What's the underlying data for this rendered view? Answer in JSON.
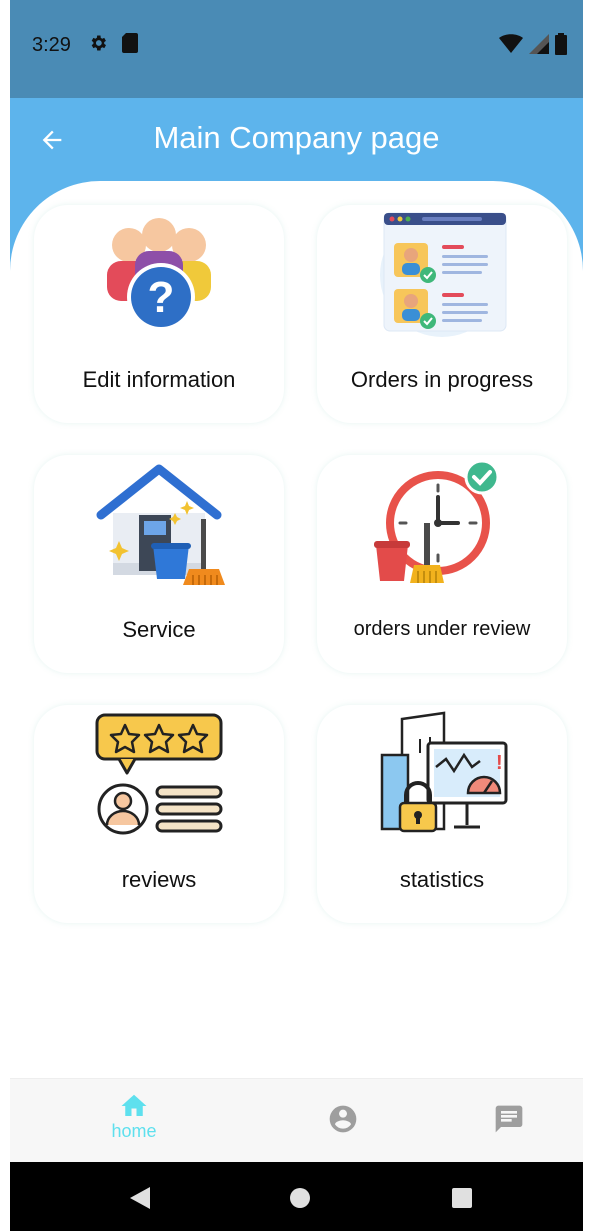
{
  "status_bar": {
    "time": "3:29",
    "icons_left": [
      "gear-icon",
      "sd-card-icon"
    ],
    "icons_right": [
      "wifi-icon",
      "signal-icon",
      "battery-icon"
    ]
  },
  "app_bar": {
    "title": "Main Company page",
    "back_icon": "arrow-left-icon",
    "color": "#5db4ec"
  },
  "cards": [
    {
      "label": "Edit information",
      "icon": "people-question-icon"
    },
    {
      "label": "Orders in progress",
      "icon": "approved-profiles-icon"
    },
    {
      "label": "Service",
      "icon": "house-cleaning-icon"
    },
    {
      "label": "orders under review",
      "icon": "clock-broom-check-icon"
    },
    {
      "label": "reviews",
      "icon": "rating-reviews-icon"
    },
    {
      "label": "statistics",
      "icon": "statistics-security-icon"
    }
  ],
  "bottom_nav": {
    "items": [
      {
        "label": "home",
        "icon": "home-icon",
        "active": true
      },
      {
        "label": "",
        "icon": "account-circle-icon",
        "active": false
      },
      {
        "label": "",
        "icon": "chat-icon",
        "active": false
      }
    ],
    "active_color": "#5ee0ee"
  },
  "system_nav": [
    "back-triangle-icon",
    "home-circle-icon",
    "recents-square-icon"
  ]
}
